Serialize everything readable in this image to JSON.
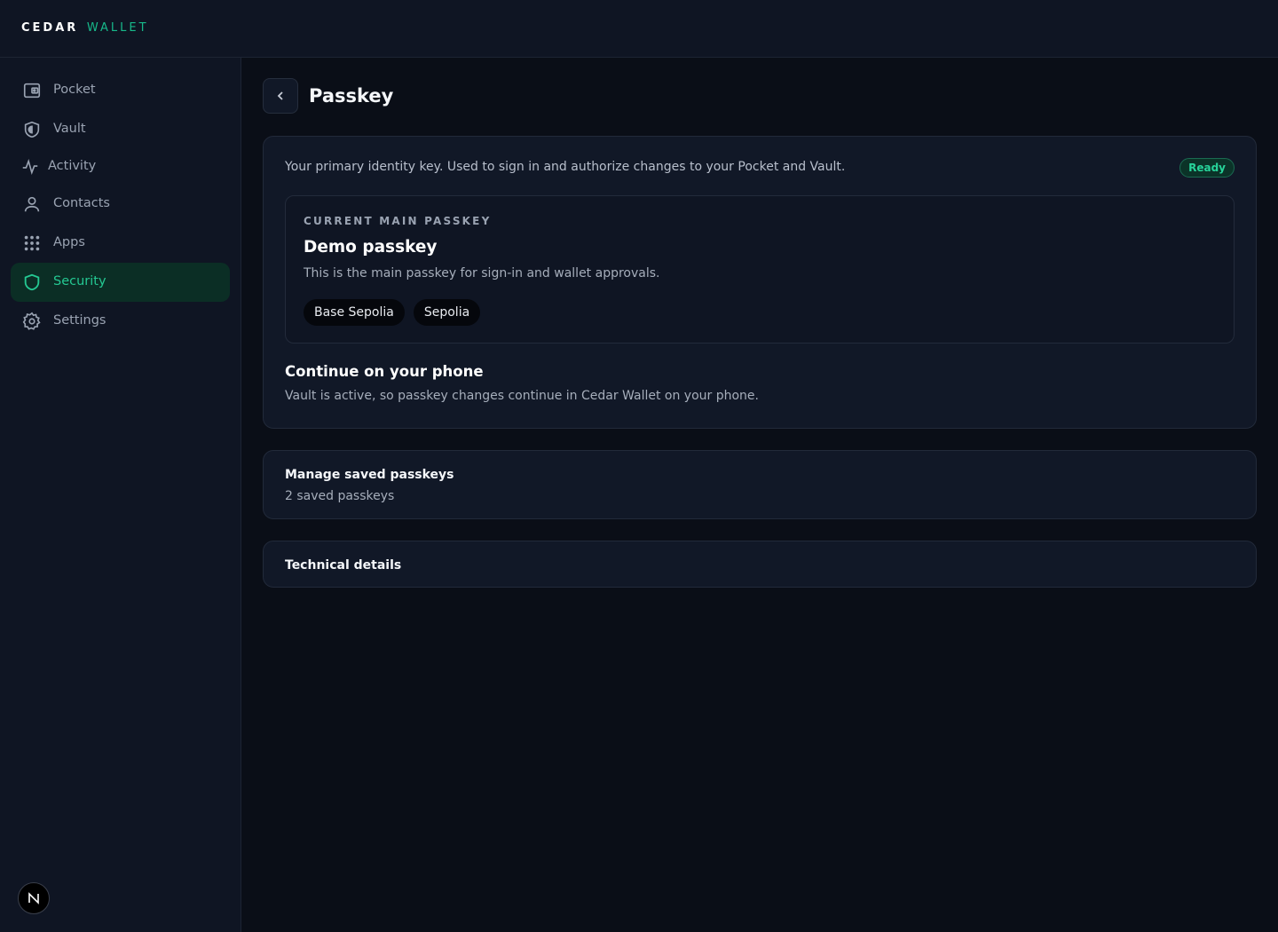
{
  "brand": {
    "primary": "CEDAR",
    "secondary": "WALLET"
  },
  "sidebar": {
    "items": [
      {
        "label": "Pocket",
        "icon": "wallet-icon",
        "active": false
      },
      {
        "label": "Vault",
        "icon": "vault-shield-icon",
        "active": false
      },
      {
        "label": "Activity",
        "icon": "activity-icon",
        "active": false
      },
      {
        "label": "Contacts",
        "icon": "person-icon",
        "active": false
      },
      {
        "label": "Apps",
        "icon": "grid-icon",
        "active": false
      },
      {
        "label": "Security",
        "icon": "shield-icon",
        "active": true
      },
      {
        "label": "Settings",
        "icon": "gear-icon",
        "active": false
      }
    ],
    "avatar_letter": "N"
  },
  "page": {
    "title": "Passkey",
    "intro": "Your primary identity key. Used to sign in and authorize changes to your Pocket and Vault.",
    "status_badge": "Ready",
    "current": {
      "eyebrow": "CURRENT MAIN PASSKEY",
      "name": "Demo passkey",
      "description": "This is the main passkey for sign-in and wallet approvals.",
      "chips": [
        "Base Sepolia",
        "Sepolia"
      ]
    },
    "phone": {
      "title": "Continue on your phone",
      "description": "Vault is active, so passkey changes continue in Cedar Wallet on your phone."
    },
    "manage": {
      "title": "Manage saved passkeys",
      "subtitle": "2 saved passkeys"
    },
    "technical": {
      "title": "Technical details"
    }
  },
  "colors": {
    "accent": "#24c892",
    "background": "#0a0e17",
    "card": "#111827",
    "active_bg": "#0b2e25"
  }
}
